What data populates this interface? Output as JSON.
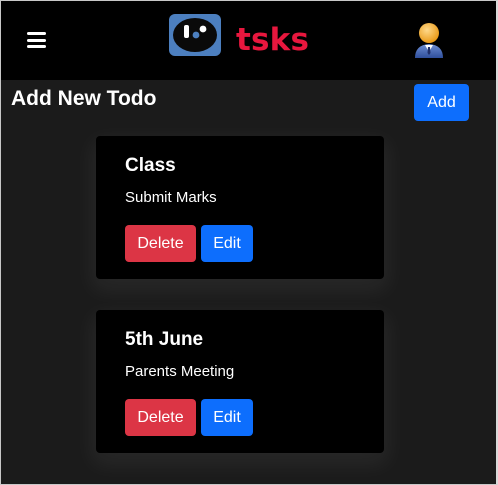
{
  "navbar": {
    "menu_icon": "hamburger-menu-icon",
    "logo_icon": "tsks-logo-icon",
    "brand": "tsks",
    "avatar_icon": "user-avatar-icon"
  },
  "page": {
    "title": "Add New Todo",
    "add_label": "Add"
  },
  "todos": [
    {
      "title": "Class",
      "description": "Submit Marks",
      "delete_label": "Delete",
      "edit_label": "Edit"
    },
    {
      "title": "5th June",
      "description": "Parents Meeting",
      "delete_label": "Delete",
      "edit_label": "Edit"
    }
  ],
  "colors": {
    "navbar_bg": "#000000",
    "page_bg": "#1b1b1b",
    "brand": "#e8173e",
    "primary": "#0d6efd",
    "danger": "#dc3545"
  }
}
